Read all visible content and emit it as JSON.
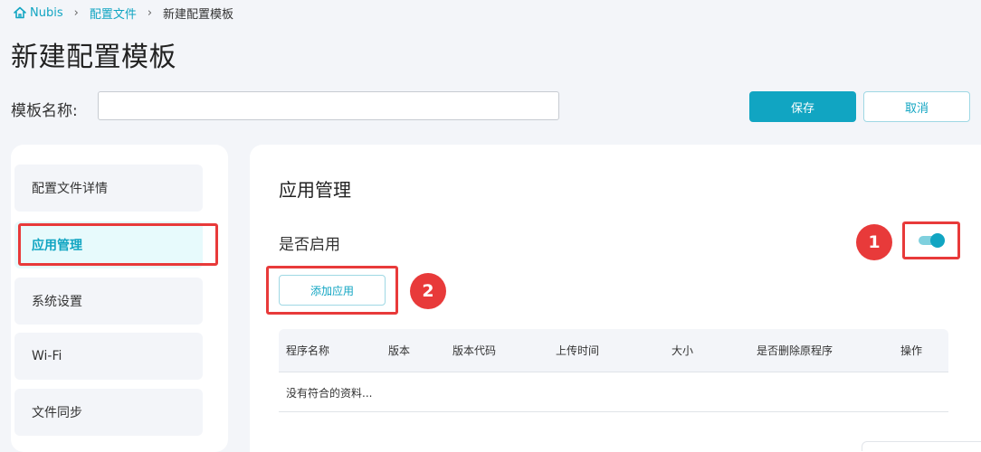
{
  "breadcrumb": {
    "home": "Nubis",
    "items": [
      "配置文件",
      "新建配置模板"
    ]
  },
  "page_title": "新建配置模板",
  "form": {
    "name_label": "模板名称:",
    "name_value": "",
    "save_label": "保存",
    "cancel_label": "取消"
  },
  "sidebar": {
    "items": [
      {
        "label": "配置文件详情",
        "active": false
      },
      {
        "label": "应用管理",
        "active": true
      },
      {
        "label": "系统设置",
        "active": false
      },
      {
        "label": "Wi-Fi",
        "active": false
      },
      {
        "label": "文件同步",
        "active": false
      }
    ]
  },
  "main": {
    "section_title": "应用管理",
    "enable_label": "是否启用",
    "enabled": true,
    "add_app_label": "添加应用",
    "table": {
      "columns": [
        "程序名称",
        "版本",
        "版本代码",
        "上传时间",
        "大小",
        "是否删除原程序",
        "操作"
      ],
      "empty_text": "没有符合的资料..."
    }
  },
  "annotations": [
    "1",
    "2"
  ],
  "colors": {
    "accent": "#11a5c2",
    "highlight": "#e83a3a",
    "background": "#f3f5f9"
  }
}
